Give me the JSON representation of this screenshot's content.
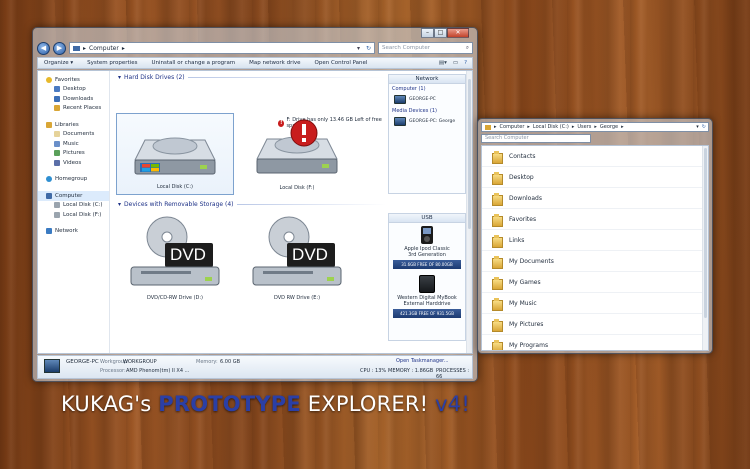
{
  "window_main": {
    "address": "Computer",
    "search_placeholder": "Search Computer",
    "caption": {
      "minimize": "–",
      "maximize": "□",
      "close": "✕"
    },
    "toolbar": {
      "organize": "Organize ▾",
      "system_properties": "System properties",
      "uninstall": "Uninstall or change a program",
      "map_drive": "Map network drive",
      "control_panel": "Open Control Panel"
    },
    "nav": {
      "favorites": {
        "label": "Favorites",
        "items": [
          "Desktop",
          "Downloads",
          "Recent Places"
        ]
      },
      "libraries": {
        "label": "Libraries",
        "items": [
          "Documents",
          "Music",
          "Pictures",
          "Videos"
        ]
      },
      "homegroup": "Homegroup",
      "computer": {
        "label": "Computer",
        "items": [
          "Local Disk (C:)",
          "Local Disk (F:)"
        ]
      },
      "network": "Network"
    },
    "groups": {
      "hard_disks": "Hard Disk Drives (2)",
      "removable": "Devices with Removable Storage (4)"
    },
    "warning_note": "F: Drive has only 13.46 GB Left of free space",
    "drives": [
      {
        "label": "Local Disk (C:)"
      },
      {
        "label": "Local Disk (F:)"
      },
      {
        "label": "DVD/CD-RW Drive (D:)",
        "badge": "DVD"
      },
      {
        "label": "DVD RW Drive (E:)",
        "badge": "DVD"
      }
    ],
    "network_box": {
      "title": "Network",
      "computer_section": "Computer (1)",
      "computer_item": "GEORGE-PC",
      "media_section": "Media Devices (1)",
      "media_item": "GEORGE-PC: George"
    },
    "usb_box": {
      "title": "USB",
      "devices": [
        {
          "name_line1": "Apple Ipod Classic",
          "name_line2": "3rd Generation",
          "capacity": "31.6GB FREE OF 80.00GB"
        },
        {
          "name_line1": "Western Digital MyBook",
          "name_line2": "External Harddrive",
          "capacity": "421.3GB FREE OF 931.5GB"
        }
      ]
    },
    "details": {
      "pc_name": "GEORGE-PC",
      "workgroup_label": "Workgroup:",
      "workgroup": "WORKGROUP",
      "memory_label": "Memory:",
      "memory": "6.00 GB",
      "processor_label": "Processor:",
      "processor": "AMD Phenom(tm) II X4 ...",
      "task_manager": "Open Taskmanager...",
      "cpu": "CPU : 13%",
      "mem_usage": "MEMORY : 1.86GB",
      "processes": "PROCESSES : 66"
    }
  },
  "window_side": {
    "breadcrumb": [
      "Computer",
      "Local Disk (C:)",
      "Users",
      "George"
    ],
    "search_placeholder": "Search Computer",
    "folders": [
      "Contacts",
      "Desktop",
      "Downloads",
      "Favorites",
      "Links",
      "My Documents",
      "My Games",
      "My Music",
      "My Pictures",
      "My Programs"
    ]
  },
  "banner": {
    "part1": "KUKAG's ",
    "accent": "PROTOTYPE",
    "part2": " EXPLORER! ",
    "version": "v4!"
  },
  "colors": {
    "accent": "#2b3fa6",
    "warning": "#c81d1d",
    "capacity_bar": "#1c3a72"
  }
}
